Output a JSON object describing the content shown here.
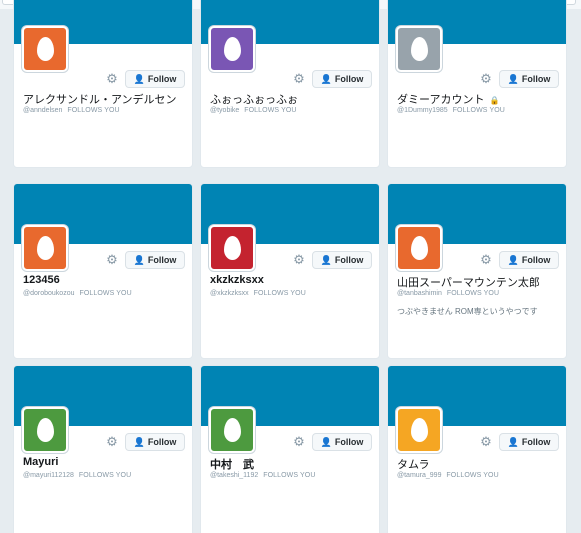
{
  "cards": [
    {
      "name": "アレクサンドル・アンデルセン",
      "handle": "@anndelsen",
      "follows_you": "FOLLOWS YOU",
      "follow_label": "Follow",
      "avatar_color": "#e8692e",
      "bold": false,
      "locked": false,
      "bio": ""
    },
    {
      "name": "ふぉっふぉっふぉ",
      "handle": "@tyobike",
      "follows_you": "FOLLOWS YOU",
      "follow_label": "Follow",
      "avatar_color": "#7a56b4",
      "bold": false,
      "locked": false,
      "bio": ""
    },
    {
      "name": "ダミーアカウント",
      "handle": "@1Dummy1985",
      "follows_you": "FOLLOWS YOU",
      "follow_label": "Follow",
      "avatar_color": "#98a3ab",
      "bold": false,
      "locked": true,
      "bio": ""
    },
    {
      "name": "123456",
      "handle": "@doroboukozou",
      "follows_you": "FOLLOWS YOU",
      "follow_label": "Follow",
      "avatar_color": "#e8692e",
      "bold": true,
      "locked": false,
      "bio": ""
    },
    {
      "name": "xkzkzksxx",
      "handle": "@xkzkzksxx",
      "follows_you": "FOLLOWS YOU",
      "follow_label": "Follow",
      "avatar_color": "#c4232f",
      "bold": true,
      "locked": false,
      "bio": ""
    },
    {
      "name": "山田スーパーマウンテン太郎",
      "handle": "@tanbashimin",
      "follows_you": "FOLLOWS YOU",
      "follow_label": "Follow",
      "avatar_color": "#e8692e",
      "bold": false,
      "locked": false,
      "bio": "つぶやきません ROM専というやつです"
    },
    {
      "name": "Mayuri",
      "handle": "@mayuri112128",
      "follows_you": "FOLLOWS YOU",
      "follow_label": "Follow",
      "avatar_color": "#4d9a3f",
      "bold": true,
      "locked": false,
      "bio": ""
    },
    {
      "name": "中村　武",
      "handle": "@takeshi_1192",
      "follows_you": "FOLLOWS YOU",
      "follow_label": "Follow",
      "avatar_color": "#4d9a3f",
      "bold": true,
      "locked": false,
      "bio": ""
    },
    {
      "name": "タムラ",
      "handle": "@tamura_999",
      "follows_you": "FOLLOWS YOU",
      "follow_label": "Follow",
      "avatar_color": "#f5a623",
      "bold": false,
      "locked": false,
      "bio": ""
    }
  ],
  "colors": {
    "banner": "#0084b4",
    "accent": "#1b95e0"
  },
  "icons": {
    "gear": "gear-icon",
    "follow": "person-add-icon",
    "lock": "lock-icon",
    "avatar": "egg-avatar-icon"
  }
}
